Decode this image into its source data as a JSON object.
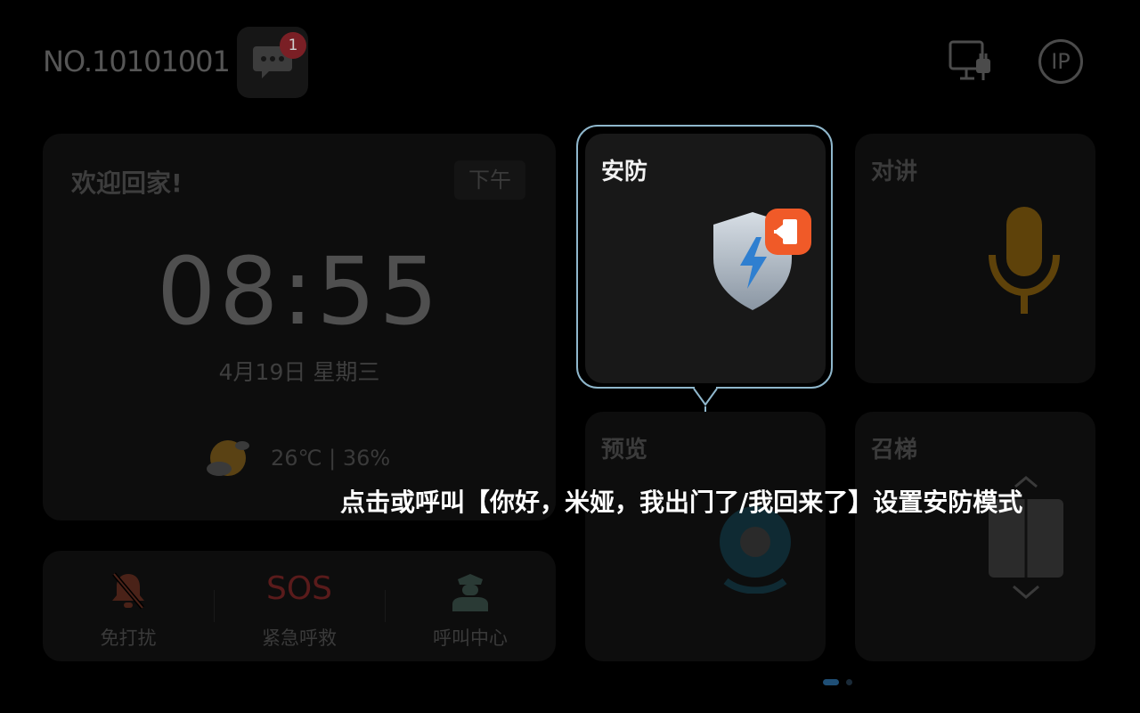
{
  "header": {
    "device_no": "NO.10101001",
    "message_badge": "1",
    "ip_label": "IP"
  },
  "welcome": {
    "title": "欢迎回家!",
    "ampm": "下午",
    "time": "08:55",
    "date": "4月19日  星期三",
    "weather": "26℃ | 36%"
  },
  "quick_actions": {
    "dnd_label": "免打扰",
    "sos_text": "SOS",
    "sos_label": "紧急呼救",
    "call_center_label": "呼叫中心"
  },
  "tiles": {
    "security": "安防",
    "intercom": "对讲",
    "preview": "预览",
    "elevator": "召梯"
  },
  "tip": {
    "text": "点击或呼叫【你好，米娅，我出门了/我回来了】设置安防模式"
  },
  "colors": {
    "highlight": "#8fb7cc",
    "badge": "#7a1f25",
    "security_badge": "#f05a28",
    "mic": "#6a4a0a"
  }
}
